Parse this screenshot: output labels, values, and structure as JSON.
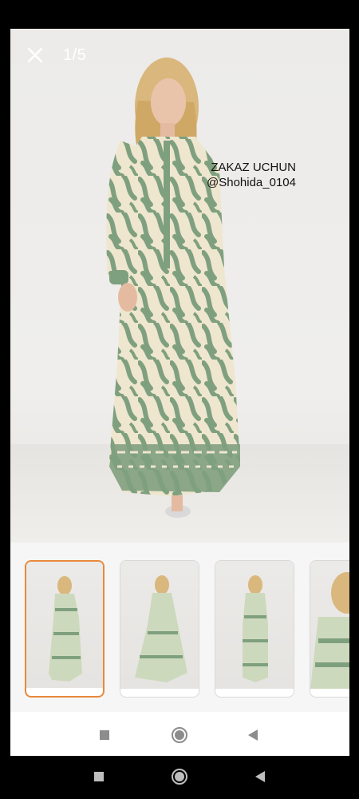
{
  "viewer": {
    "counter": "1/5",
    "close_icon": "close-icon"
  },
  "photo": {
    "watermark_line1": "ZAKAZ UCHUN",
    "watermark_line2": "@Shohida_0104"
  },
  "thumbnails": {
    "selected_index": 0,
    "count_visible": 4
  },
  "navigation": {
    "inner": [
      "recents-icon",
      "home-icon",
      "back-icon"
    ],
    "system": [
      "recents-icon",
      "home-icon",
      "back-icon"
    ]
  },
  "colors": {
    "accent": "#e8893c",
    "dress_green": "#7fa07e",
    "dress_cream": "#efe6cf"
  }
}
